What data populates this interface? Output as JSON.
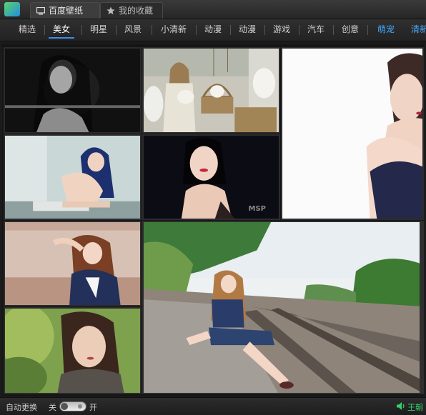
{
  "tabs": [
    {
      "label": "百度壁纸",
      "icon": "monitor-icon"
    },
    {
      "label": "我的收藏",
      "icon": "star-icon"
    }
  ],
  "categories": [
    "精选",
    "美女",
    "明星",
    "风景",
    "小清新",
    "动漫",
    "动漫",
    "游戏",
    "汽车",
    "创意",
    "萌宠",
    "清新"
  ],
  "selected_category": "美女",
  "colors": {
    "accent": "#3c8ee0",
    "category_accent": "#45a7ff",
    "now_playing": "#34d26a"
  },
  "gallery": {
    "tiles": [
      {
        "name": "tile-bw-portrait"
      },
      {
        "name": "tile-girl-with-dogs"
      },
      {
        "name": "tile-strapless-dress"
      },
      {
        "name": "tile-blue-hair-sitting"
      },
      {
        "name": "tile-dark-portrait",
        "watermark": "MSP"
      },
      {
        "name": "tile-sunlight-portrait"
      },
      {
        "name": "tile-railway-girl"
      },
      {
        "name": "tile-green-portrait"
      }
    ]
  },
  "bottom": {
    "auto_change_label": "自动更换",
    "off_label": "关",
    "on_label": "开",
    "now_playing": "王朝"
  }
}
